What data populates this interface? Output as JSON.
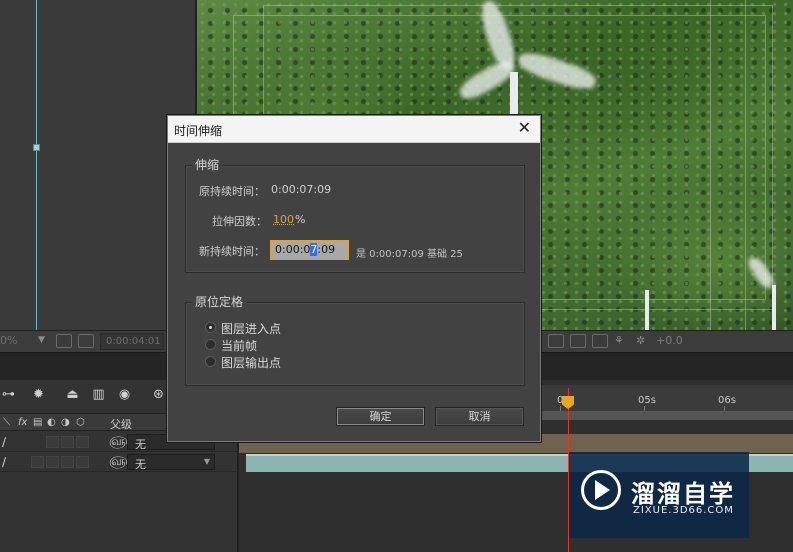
{
  "dialog": {
    "title": "时间伸缩",
    "close_glyph": "✕",
    "stretch_group": {
      "label": "伸缩",
      "original_duration_label": "原持续时间：",
      "original_duration_value": "0:00:07:09",
      "stretch_factor_label": "拉伸因数：",
      "stretch_factor_value": "100",
      "stretch_factor_unit": "%",
      "new_duration_label": "新持续时间：",
      "new_duration_before": "0:00:0",
      "new_duration_selected": "7",
      "new_duration_after": ":09",
      "new_duration_info": "是 0:00:07:09  基础 25"
    },
    "hold_group": {
      "label": "原位定格",
      "options": [
        {
          "label": "图层进入点",
          "selected": true
        },
        {
          "label": "当前帧",
          "selected": false
        },
        {
          "label": "图层输出点",
          "selected": false
        }
      ]
    },
    "ok_label": "确定",
    "cancel_label": "取消"
  },
  "viewer_toolbar": {
    "zoom": "0%",
    "timecode": "0:00:04:01",
    "exposure": "+0.0"
  },
  "timeline": {
    "ruler_ticks": [
      "0",
      "05s",
      "06s"
    ],
    "header_fx": "fx",
    "parent_column_label": "父级",
    "rows": [
      {
        "parent": "无"
      },
      {
        "parent": "无"
      }
    ]
  },
  "watermark": {
    "brand_cn": "溜溜自学",
    "brand_url": "ZIXUE.3D66.COM"
  },
  "colors": {
    "accent_orange": "#e3a22b",
    "current_time_indicator": "#e0362c",
    "dialog_bg": "#424242"
  }
}
